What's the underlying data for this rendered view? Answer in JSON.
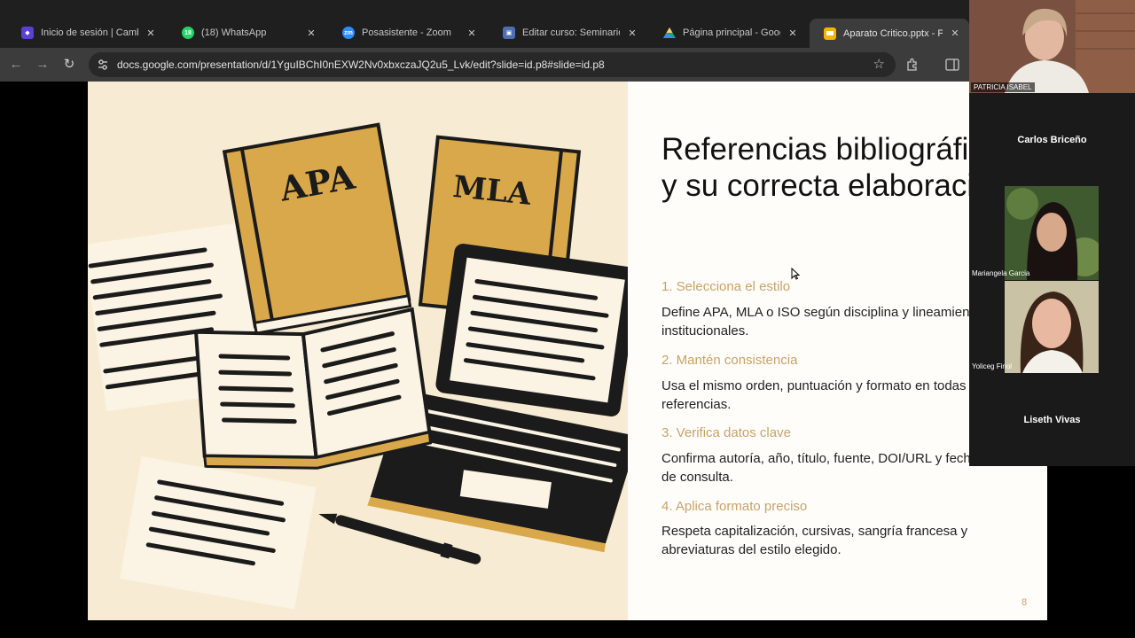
{
  "browser": {
    "tabs": [
      {
        "label": "Inicio de sesión | Cambridge",
        "icon": "cambridge-icon",
        "color": "#5b3fd6",
        "badge": ""
      },
      {
        "label": "(18) WhatsApp",
        "icon": "whatsapp-icon",
        "color": "#25d366",
        "badge": "18"
      },
      {
        "label": "Posasistente - Zoom",
        "icon": "zoom-icon",
        "color": "#2d8cff",
        "badge": "zm"
      },
      {
        "label": "Editar curso: Seminario I. Pr",
        "icon": "moodle-icon",
        "color": "#4f6fb3",
        "badge": ""
      },
      {
        "label": "Página principal - Google D",
        "icon": "google-drive-icon",
        "color": "#1fa463",
        "badge": ""
      },
      {
        "label": "Aparato Critico.pptx - Prese",
        "icon": "google-slides-icon",
        "color": "#f4b400",
        "badge": ""
      }
    ],
    "close_glyph": "✕",
    "url": "docs.google.com/presentation/d/1YguIBChI0nEXW2Nv0xbxczaJQ2u5_Lvk/edit?slide=id.p8#slide=id.p8"
  },
  "slide": {
    "title": "Referencias bibliográficas y su correcta elaboración",
    "steps": [
      {
        "heading": "1. Selecciona el estilo",
        "body": "Define APA, MLA o ISO según disciplina y lineamientos institucionales."
      },
      {
        "heading": "2. Mantén consistencia",
        "body": "Usa el mismo orden, puntuación y formato en todas las referencias."
      },
      {
        "heading": "3. Verifica datos clave",
        "body": "Confirma autoría, año, título, fuente, DOI/URL y fechas de consulta."
      },
      {
        "heading": "4. Aplica formato preciso",
        "body": "Respeta capitalización, cursivas, sangría francesa y abreviaturas del estilo elegido."
      }
    ],
    "book1_label": "APA",
    "book2_label": "MLA",
    "page_number": "8",
    "colors": {
      "accent": "#c9a26a",
      "book": "#d9a84a",
      "paper": "#fbf3e3",
      "ink": "#1b1b1b"
    }
  },
  "zoom": {
    "participants": [
      {
        "name": "PATRICIA ISABEL",
        "type": "video"
      },
      {
        "name": "Carlos Briceño",
        "type": "text"
      },
      {
        "name": "Mariangela Garcia",
        "type": "video"
      },
      {
        "name": "Yoliceg Finol",
        "type": "video"
      },
      {
        "name": "Liseth Vivas",
        "type": "text"
      }
    ]
  }
}
